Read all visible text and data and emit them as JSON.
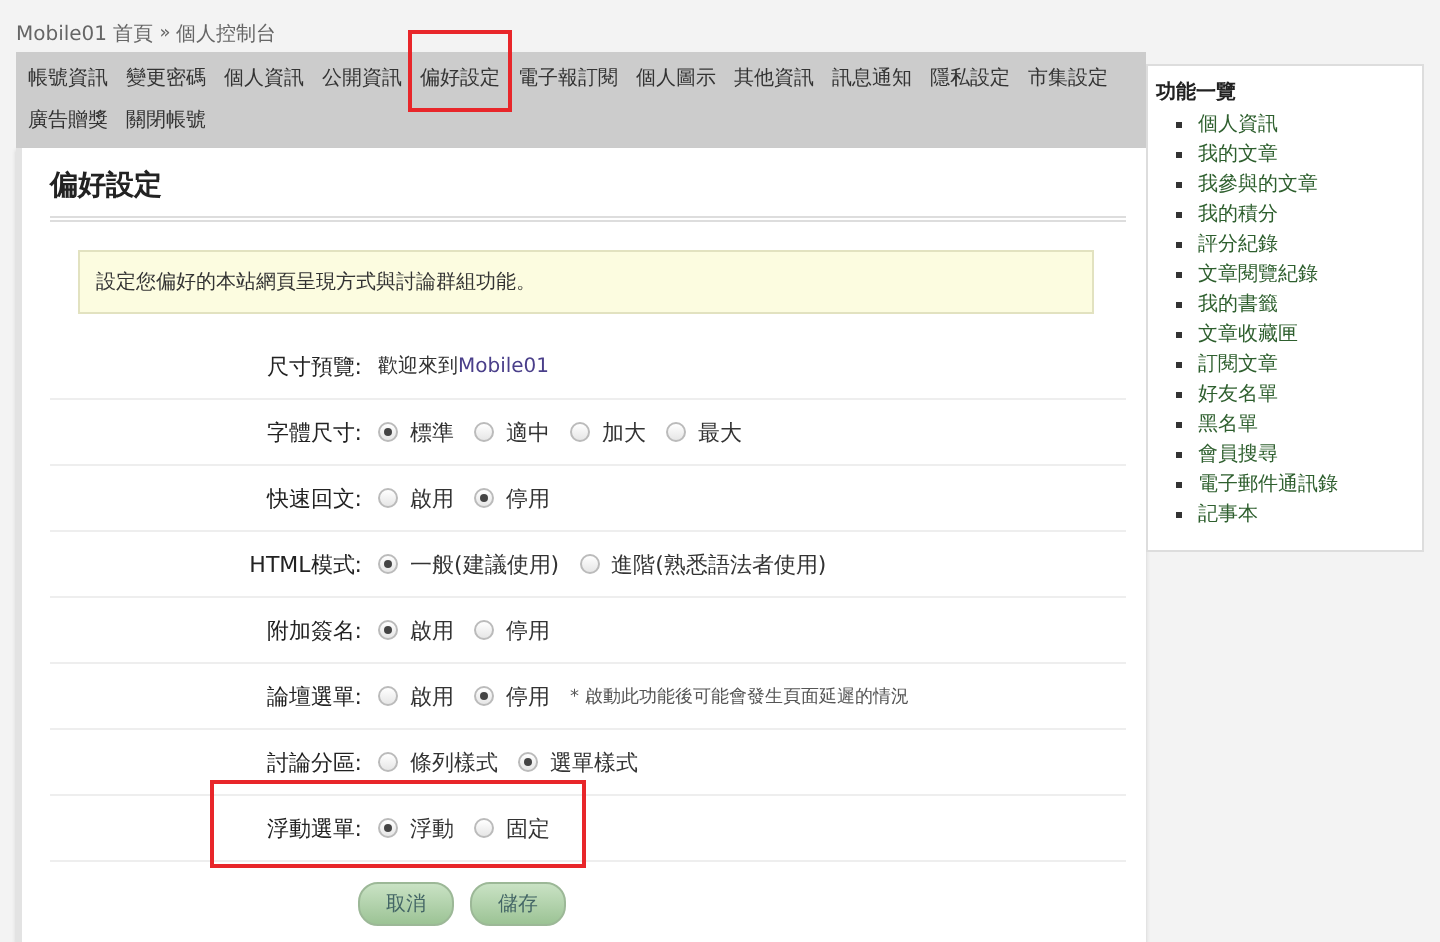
{
  "breadcrumb": {
    "home": "Mobile01 首頁",
    "separator": "»",
    "current": "個人控制台"
  },
  "nav": [
    {
      "label": "帳號資訊",
      "highlighted": false
    },
    {
      "label": "變更密碼",
      "highlighted": false
    },
    {
      "label": "個人資訊",
      "highlighted": false
    },
    {
      "label": "公開資訊",
      "highlighted": false
    },
    {
      "label": "偏好設定",
      "highlighted": true
    },
    {
      "label": "電子報訂閱",
      "highlighted": false
    },
    {
      "label": "個人圖示",
      "highlighted": false
    },
    {
      "label": "其他資訊",
      "highlighted": false
    },
    {
      "label": "訊息通知",
      "highlighted": false
    },
    {
      "label": "隱私設定",
      "highlighted": false
    },
    {
      "label": "市集設定",
      "highlighted": false
    },
    {
      "label": "廣告贈獎",
      "highlighted": false
    },
    {
      "label": "關閉帳號",
      "highlighted": false
    }
  ],
  "page_title": "偏好設定",
  "notice": "設定您偏好的本站網頁呈現方式與討論群組功能。",
  "preview": {
    "label": "尺寸預覽:",
    "text": "歡迎來到",
    "link": "Mobile01"
  },
  "settings": [
    {
      "label": "字體尺寸:",
      "highlighted": false,
      "options": [
        {
          "label": "標準",
          "selected": true
        },
        {
          "label": "適中",
          "selected": false
        },
        {
          "label": "加大",
          "selected": false
        },
        {
          "label": "最大",
          "selected": false
        }
      ]
    },
    {
      "label": "快速回文:",
      "highlighted": false,
      "options": [
        {
          "label": "啟用",
          "selected": false
        },
        {
          "label": "停用",
          "selected": true
        }
      ]
    },
    {
      "label": "HTML模式:",
      "highlighted": false,
      "options": [
        {
          "label": "一般(建議使用)",
          "selected": true
        },
        {
          "label": "進階(熟悉語法者使用)",
          "selected": false
        }
      ]
    },
    {
      "label": "附加簽名:",
      "highlighted": false,
      "options": [
        {
          "label": "啟用",
          "selected": true
        },
        {
          "label": "停用",
          "selected": false
        }
      ]
    },
    {
      "label": "論壇選單:",
      "highlighted": false,
      "note": "* 啟動此功能後可能會發生頁面延遲的情況",
      "options": [
        {
          "label": "啟用",
          "selected": false
        },
        {
          "label": "停用",
          "selected": true
        }
      ]
    },
    {
      "label": "討論分區:",
      "highlighted": false,
      "options": [
        {
          "label": "條列樣式",
          "selected": false
        },
        {
          "label": "選單樣式",
          "selected": true
        }
      ]
    },
    {
      "label": "浮動選單:",
      "highlighted": true,
      "options": [
        {
          "label": "浮動",
          "selected": true
        },
        {
          "label": "固定",
          "selected": false
        }
      ]
    }
  ],
  "buttons": [
    "取消",
    "儲存"
  ],
  "sidebar": {
    "title": "功能一覽",
    "items": [
      "個人資訊",
      "我的文章",
      "我參與的文章",
      "我的積分",
      "評分紀錄",
      "文章閱覽紀錄",
      "我的書籤",
      "文章收藏匣",
      "訂閱文章",
      "好友名單",
      "黑名單",
      "會員搜尋",
      "電子郵件通訊錄",
      "記事本"
    ]
  }
}
